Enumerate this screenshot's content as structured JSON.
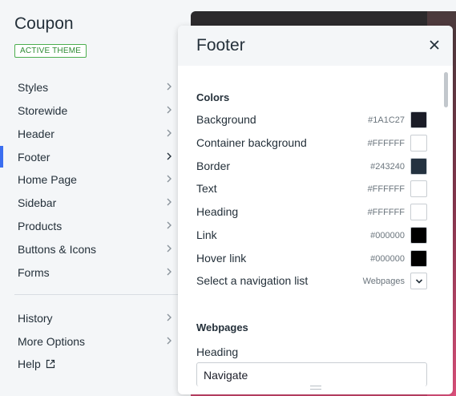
{
  "theme": {
    "name": "Coupon",
    "badge": "ACTIVE THEME"
  },
  "nav": {
    "items": [
      {
        "label": "Styles",
        "active": false
      },
      {
        "label": "Storewide",
        "active": false
      },
      {
        "label": "Header",
        "active": false
      },
      {
        "label": "Footer",
        "active": true
      },
      {
        "label": "Home Page",
        "active": false
      },
      {
        "label": "Sidebar",
        "active": false
      },
      {
        "label": "Products",
        "active": false
      },
      {
        "label": "Buttons & Icons",
        "active": false
      },
      {
        "label": "Forms",
        "active": false
      }
    ],
    "secondary": [
      {
        "label": "History"
      },
      {
        "label": "More Options"
      },
      {
        "label": "Help",
        "icon": "external-link-icon"
      }
    ]
  },
  "panel": {
    "title": "Footer",
    "close_icon": "close-icon",
    "colors_section": "Colors",
    "colors": [
      {
        "label": "Background",
        "value": "#1A1C27",
        "swatch": "#1A1C27"
      },
      {
        "label": "Container background",
        "value": "#FFFFFF",
        "swatch": "#FFFFFF"
      },
      {
        "label": "Border",
        "value": "#243240",
        "swatch": "#243240"
      },
      {
        "label": "Text",
        "value": "#FFFFFF",
        "swatch": "#FFFFFF"
      },
      {
        "label": "Heading",
        "value": "#FFFFFF",
        "swatch": "#FFFFFF"
      },
      {
        "label": "Link",
        "value": "#000000",
        "swatch": "#000000"
      },
      {
        "label": "Hover link",
        "value": "#000000",
        "swatch": "#000000"
      }
    ],
    "nav_list": {
      "label": "Select a navigation list",
      "value": "Webpages"
    },
    "webpages_section": "Webpages",
    "heading_field": {
      "label": "Heading",
      "value": "Navigate"
    }
  },
  "accent": "#3B6EF0",
  "badge_color": "#4CAE4F"
}
